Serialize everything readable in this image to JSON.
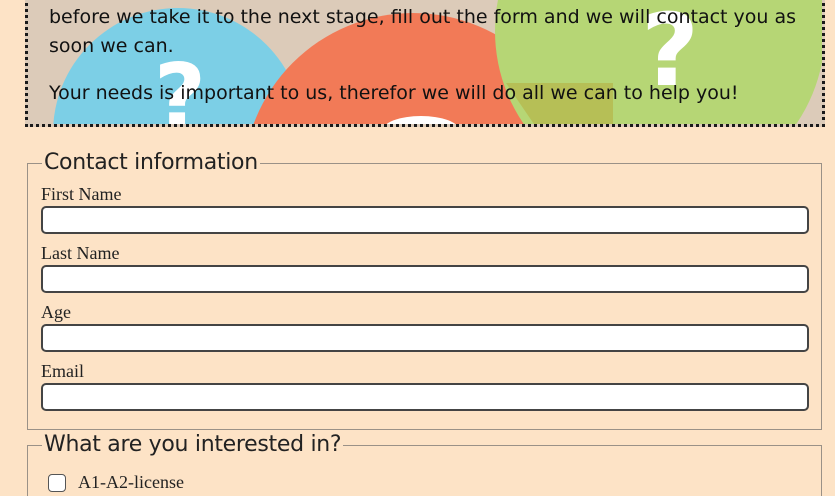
{
  "intro": {
    "line1": "before we take it to the next stage, fill out the form and we will contact you as soon we can.",
    "line2": "Your needs is important to us, therefor we will do all we can to help you!"
  },
  "contact": {
    "legend": "Contact information",
    "fields": [
      {
        "label": "First Name",
        "value": ""
      },
      {
        "label": "Last Name",
        "value": ""
      },
      {
        "label": "Age",
        "value": ""
      },
      {
        "label": "Email",
        "value": ""
      }
    ]
  },
  "interest": {
    "legend": "What are you interested in?",
    "options": [
      {
        "label": "A1-A2-license",
        "checked": false
      }
    ]
  },
  "colors": {
    "page_bg": "#fde3c6",
    "banner_bg": "#dccbb9",
    "blue_bubble": "#7ccfe6",
    "orange_bubble": "#f27a57",
    "green_bubble": "#b6d675"
  }
}
